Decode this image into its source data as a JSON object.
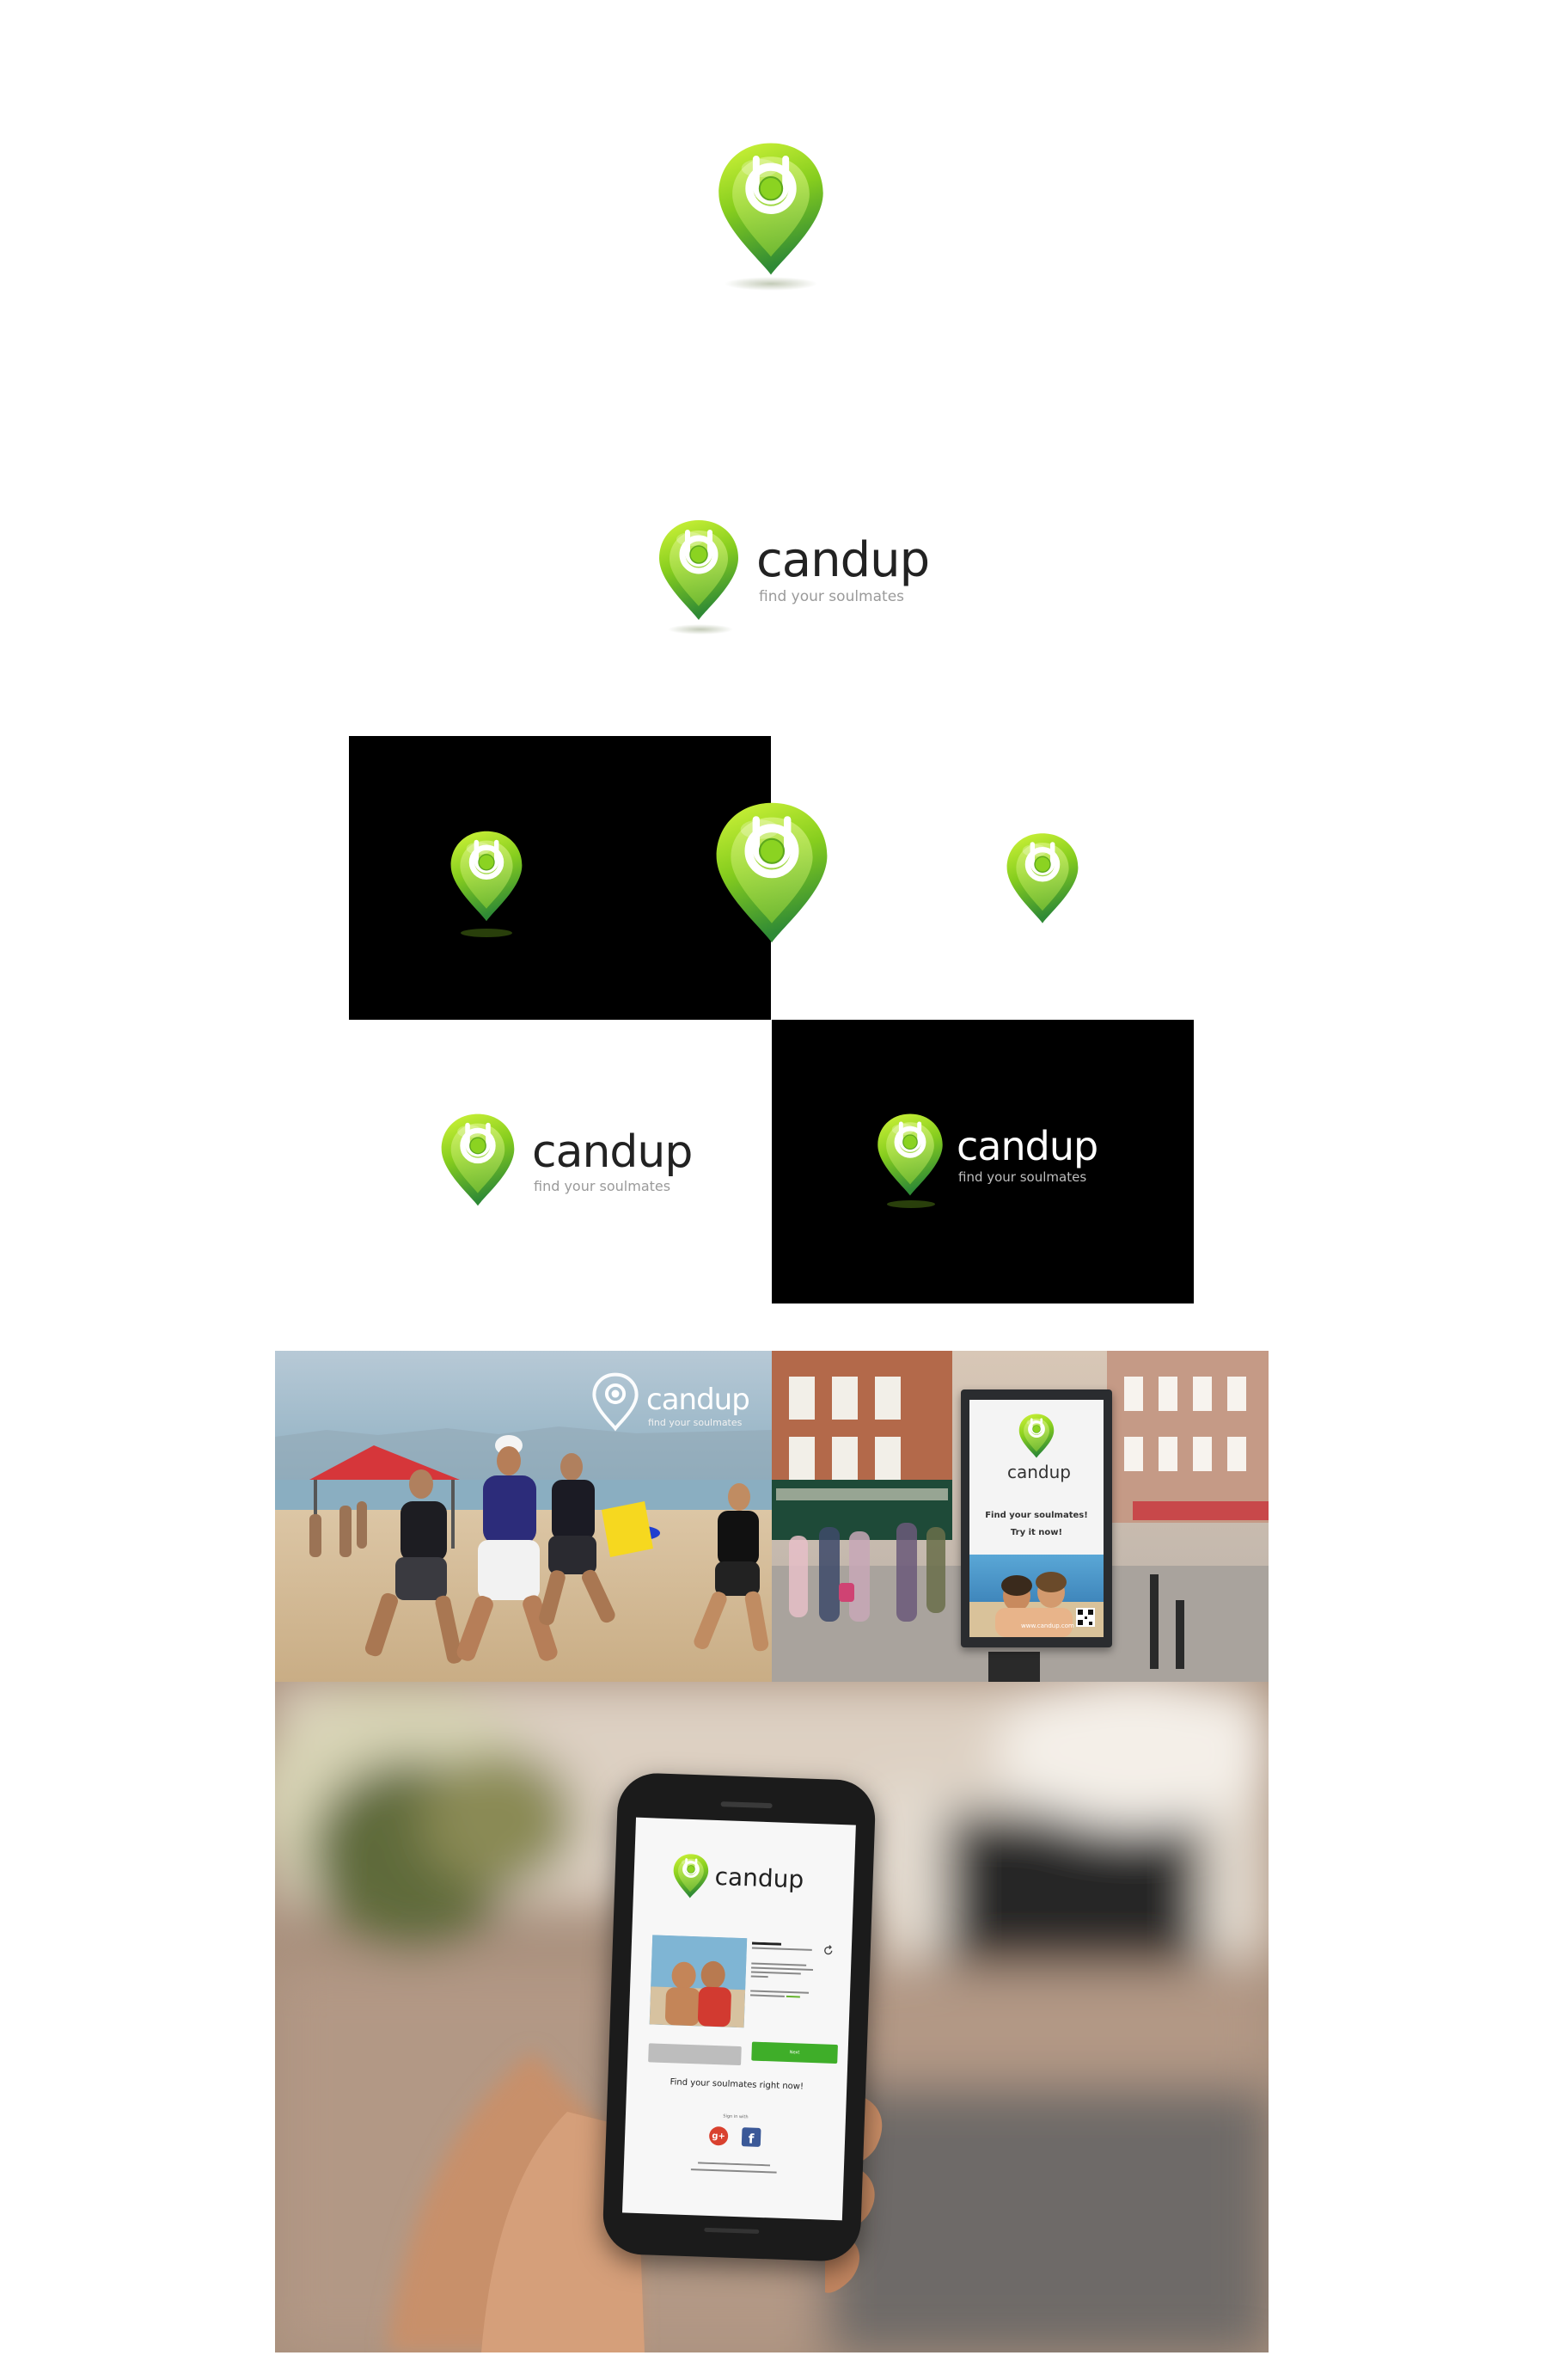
{
  "brand": {
    "name": "candup",
    "tagline": "find your soulmates",
    "colors": {
      "green_light": "#c6ef2a",
      "green": "#7cc420",
      "green_dark": "#2f8a35",
      "text_dark": "#222222",
      "tagline_grey": "#9a9a9a"
    }
  },
  "billboard": {
    "headline": "Find your soulmates!",
    "cta": "Try it now!",
    "url": "www.candup.com"
  },
  "phone": {
    "right_button": "Next",
    "slogan": "Find your soulmates right now!",
    "sign_in_label": "Sign in with",
    "social": [
      "google-plus-icon",
      "facebook-icon"
    ],
    "social_labels": {
      "google": "g+",
      "facebook": "f"
    }
  },
  "chart_data": null
}
